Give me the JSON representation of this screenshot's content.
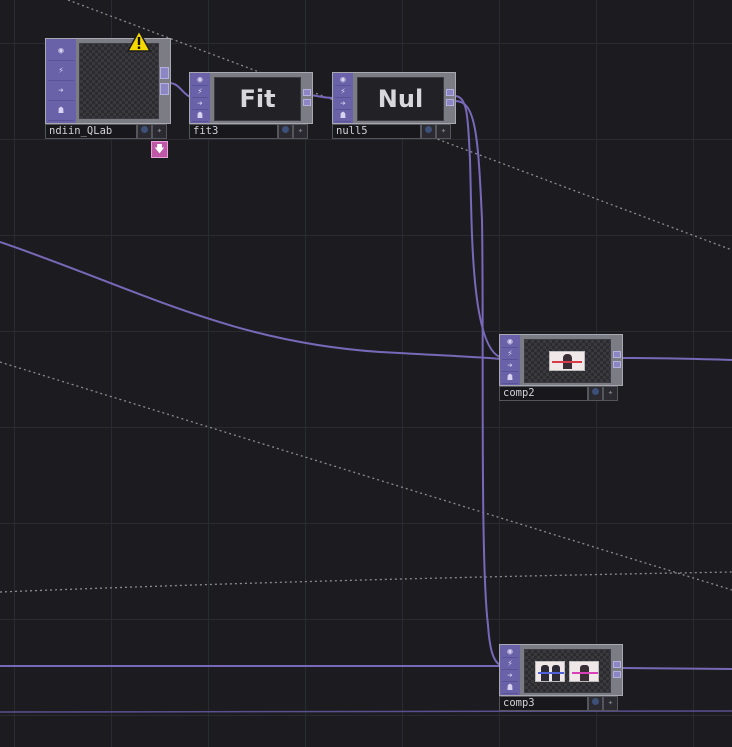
{
  "nodes": {
    "ndiin": {
      "name": "ndiin_QLab",
      "warning": true
    },
    "fit": {
      "name": "fit3",
      "label": "Fit"
    },
    "null": {
      "name": "null5",
      "label": "Nul"
    },
    "comp2": {
      "name": "comp2"
    },
    "comp3": {
      "name": "comp3"
    }
  },
  "colors": {
    "background": "#1c1c20",
    "wire": "#7868b8",
    "operator_strip": "#6a62a8",
    "warning": "#f5d800"
  },
  "icons": {
    "warning": "warning-icon",
    "viewer": "viewer-icon",
    "bypass": "bypass-icon",
    "pass": "arrow-icon",
    "lock": "lock-icon",
    "display_flag": "display-flag-icon",
    "render_flag": "render-flag-icon"
  }
}
